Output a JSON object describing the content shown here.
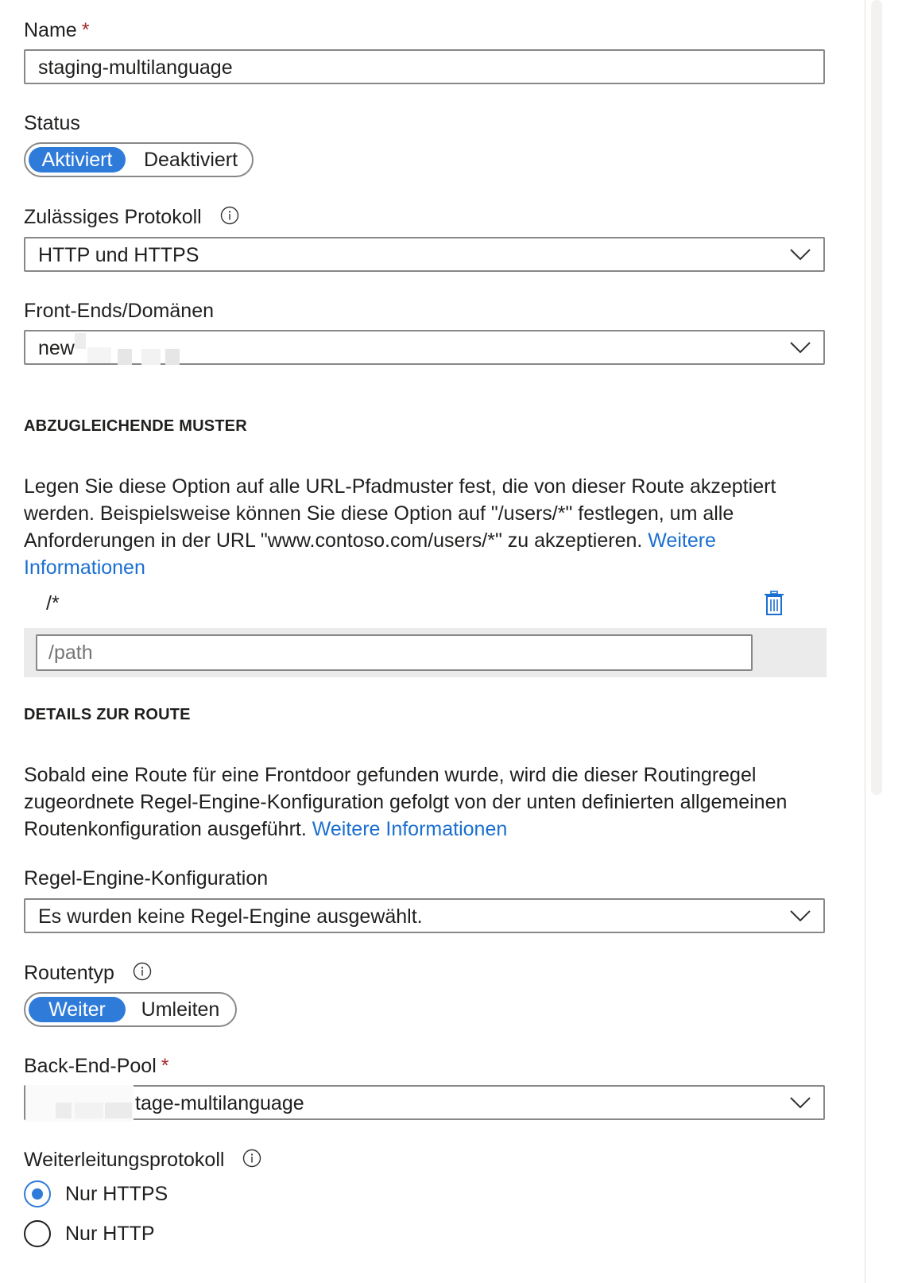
{
  "name": {
    "label": "Name",
    "required_mark": "*",
    "value": "staging-multilanguage"
  },
  "status": {
    "label": "Status",
    "options": [
      "Aktiviert",
      "Deaktiviert"
    ],
    "selected": "Aktiviert"
  },
  "protocol": {
    "label": "Zulässiges Protokoll",
    "value": "HTTP und HTTPS",
    "info_icon": "info-icon"
  },
  "frontends": {
    "label": "Front-Ends/Domänen",
    "value": "new"
  },
  "patterns": {
    "heading": "ABZUGLEICHENDE MUSTER",
    "description": "Legen Sie diese Option auf alle URL-Pfadmuster fest, die von dieser Route akzeptiert werden. Beispielsweise können Sie diese Option auf \"/users/*\" festlegen, um alle Anforderungen in der URL \"www.contoso.com/users/*\" zu akzeptieren. ",
    "link": "Weitere Informationen",
    "items": [
      "/*"
    ],
    "new_placeholder": "/path",
    "delete_icon": "trash-icon"
  },
  "route_details": {
    "heading": "DETAILS ZUR ROUTE",
    "description": "Sobald eine Route für eine Frontdoor gefunden wurde, wird die dieser Routingregel zugeordnete Regel-Engine-Konfiguration gefolgt von der unten definierten allgemeinen Routenkonfiguration ausgeführt. ",
    "link": "Weitere Informationen"
  },
  "rules_engine": {
    "label": "Regel-Engine-Konfiguration",
    "value": "Es wurden keine Regel-Engine ausgewählt."
  },
  "route_type": {
    "label": "Routentyp",
    "options": [
      "Weiter",
      "Umleiten"
    ],
    "selected": "Weiter",
    "info_icon": "info-icon"
  },
  "backend_pool": {
    "label": "Back-End-Pool",
    "required_mark": "*",
    "value": "tage-multilanguage"
  },
  "forwarding_protocol": {
    "label": "Weiterleitungsprotokoll",
    "info_icon": "info-icon",
    "options": [
      "Nur HTTPS",
      "Nur HTTP"
    ],
    "selected": "Nur HTTPS"
  },
  "colors": {
    "accent": "#2f7bd9",
    "link": "#1a6fd0",
    "required": "#a4262c"
  }
}
